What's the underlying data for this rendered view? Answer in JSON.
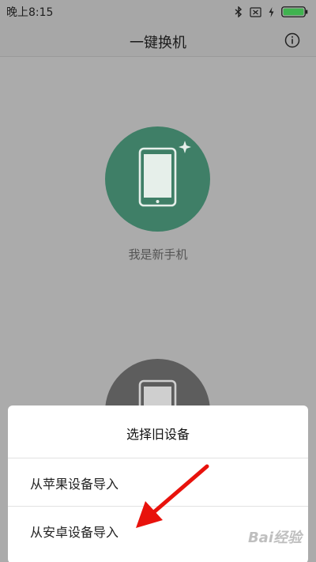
{
  "status_bar": {
    "time": "晚上8:15"
  },
  "header": {
    "title": "一键换机"
  },
  "main": {
    "new_phone_label": "我是新手机"
  },
  "sheet": {
    "title": "选择旧设备",
    "items": [
      {
        "label": "从苹果设备导入"
      },
      {
        "label": "从安卓设备导入"
      }
    ]
  },
  "watermark": {
    "text": "Bai经验"
  },
  "colors": {
    "accent_green": "#3f7f67",
    "battery_green": "#3fb34f",
    "arrow_red": "#e8120c"
  }
}
